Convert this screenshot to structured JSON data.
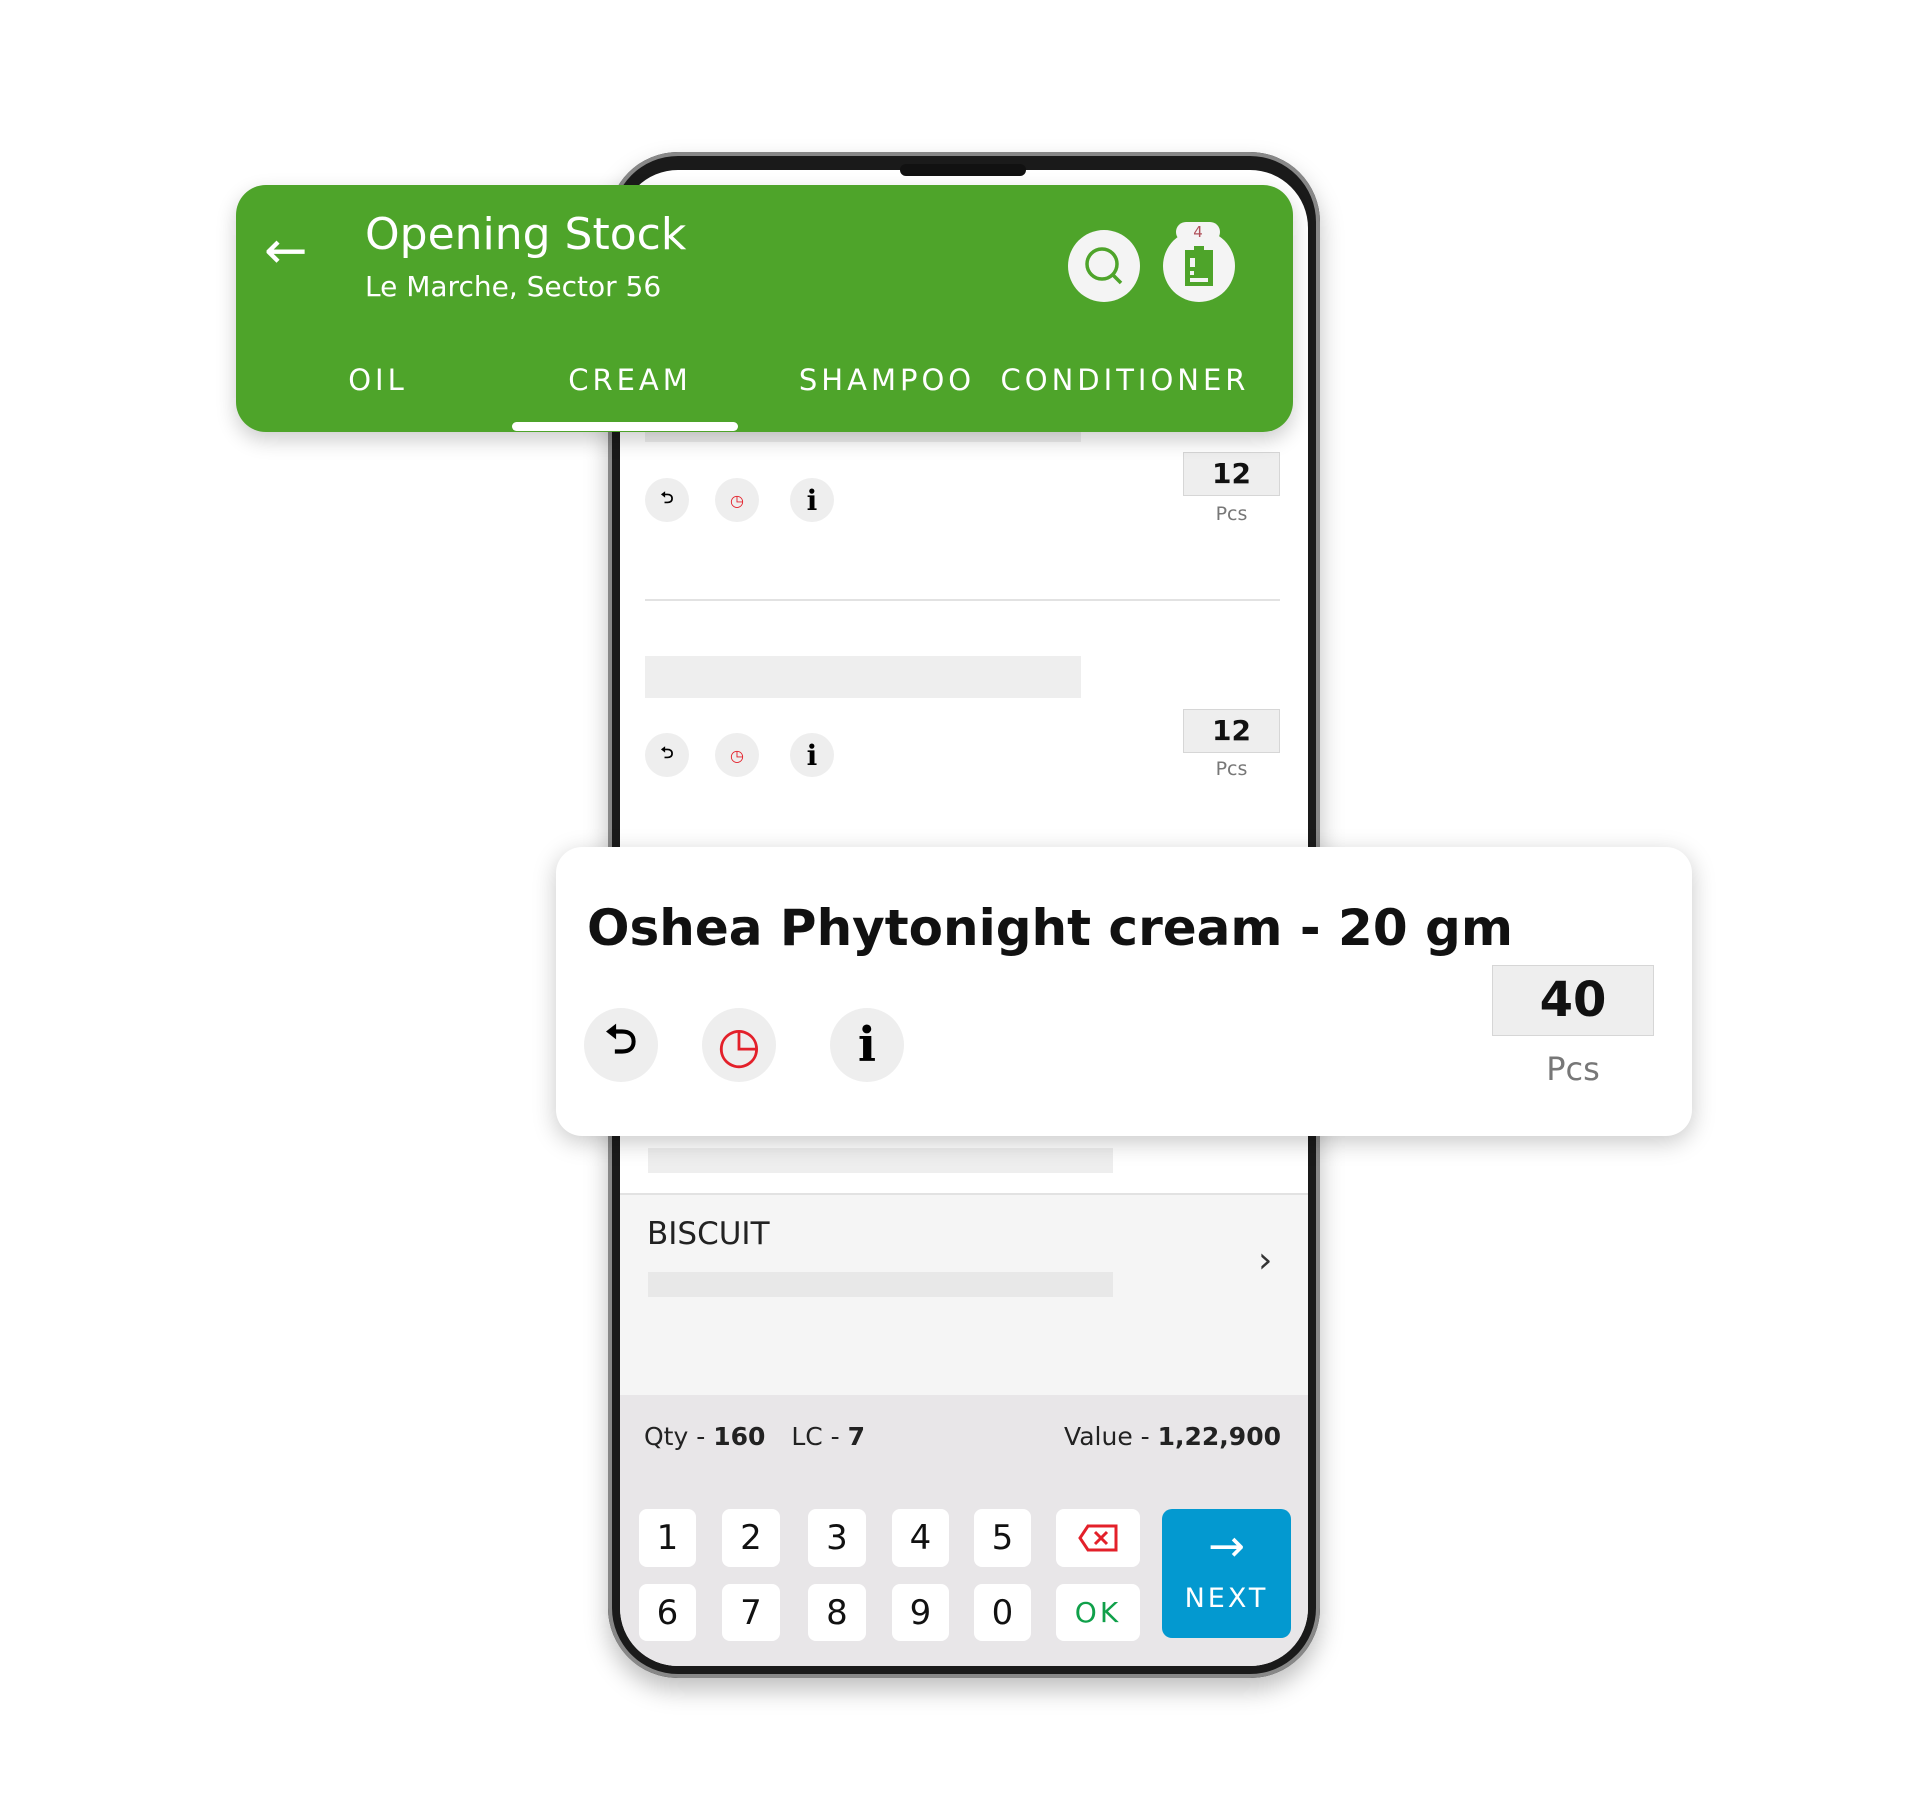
{
  "header": {
    "title": "Opening Stock",
    "subtitle": "Le Marche, Sector 56",
    "cart_count": "4",
    "back_icon": "arrow-left-icon",
    "search_icon": "search-icon",
    "cart_icon": "clipboard-icon",
    "color": "#4ea42a"
  },
  "tabs": [
    {
      "label": "OIL"
    },
    {
      "label": "CREAM",
      "active": true
    },
    {
      "label": "SHAMPOO"
    },
    {
      "label": "CONDITIONER"
    }
  ],
  "items": [
    {
      "qty": "12",
      "unit": "Pcs"
    },
    {
      "qty": "12",
      "unit": "Pcs"
    }
  ],
  "focused_item": {
    "name": "Oshea Phytonight cream - 20 gm",
    "qty": "40",
    "unit": "Pcs"
  },
  "category": {
    "label": "BISCUIT"
  },
  "summary": {
    "qty_label": "Qty - ",
    "qty": "160",
    "lc_label": "LC - ",
    "lc": "7",
    "value_label": "Value - ",
    "value": "1,22,900"
  },
  "keypad": {
    "keys_row1": [
      "1",
      "2",
      "3",
      "4",
      "5"
    ],
    "keys_row2": [
      "6",
      "7",
      "8",
      "9",
      "0"
    ],
    "ok": "OK",
    "next": "NEXT",
    "next_color": "#0399d0"
  }
}
